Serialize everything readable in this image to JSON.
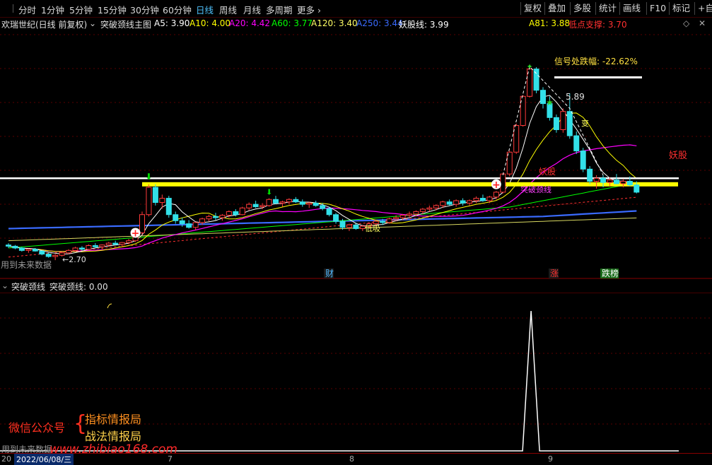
{
  "toolbar": {
    "periods": [
      "分时",
      "1分钟",
      "5分钟",
      "15分钟",
      "30分钟",
      "60分钟",
      "日线",
      "周线",
      "月线",
      "多周期",
      "更多"
    ],
    "active_period": "日线",
    "right_buttons": [
      "复权",
      "叠加",
      "多股",
      "统计",
      "画线",
      "F10",
      "标记",
      "+自选"
    ]
  },
  "info": {
    "stock": "欢瑞世纪(日线 前复权)",
    "indicator": "突破颈线主图",
    "ma": [
      {
        "label": "A5: 3.90",
        "color": "#ffffff"
      },
      {
        "label": "A10: 4.00",
        "color": "#ffff00"
      },
      {
        "label": "A20: 4.42",
        "color": "#ff00ff"
      },
      {
        "label": "A60: 3.77",
        "color": "#00ff00"
      },
      {
        "label": "A120: 3.40",
        "color": "#ffff66"
      },
      {
        "label": "A250: 3.44",
        "color": "#3a6bff"
      },
      {
        "label": "妖股线: 3.99",
        "color": "#ffffff"
      }
    ],
    "a81": "A81: 3.88",
    "support": "低点支撑: 3.70",
    "colors": {
      "a81": "#ffff00",
      "support": "#ff3030"
    }
  },
  "annotations": {
    "drop_label": "信号处跌幅: -22.62%",
    "high_price": "5.89",
    "low_price": "2.70",
    "yaogu_right": "妖股",
    "yaogu_mid": "妖股",
    "neck_text": "突破颈线",
    "bian": "变",
    "dixi": "低吸",
    "future_data": "用到未来数据",
    "markers": [
      "财",
      "涨",
      "跌榜"
    ]
  },
  "sub": {
    "title": "突破颈线",
    "value_label": "突破颈线: 0.00",
    "future_data": "用到未来数据"
  },
  "watermark": {
    "wechat": "微信公众号",
    "line1": "指标情报局",
    "line2": "战法情报局",
    "url": "www.zhibiao168.com"
  },
  "bottom": {
    "date": "2022/06/08/三",
    "prefix": "20",
    "months": [
      "7",
      "8",
      "9"
    ]
  },
  "chart_data": {
    "type": "candlestick",
    "ma_colors": {
      "a5": "#ffffff",
      "a10": "#ffff00",
      "a20": "#ff00ff",
      "a60": "#00ff00",
      "a250": "#3a6bff",
      "support": "#ff3030"
    },
    "neck_price": 3.95,
    "white_line_price": 4.05,
    "candles": [
      [
        2.95,
        2.98,
        2.9,
        2.93
      ],
      [
        2.93,
        2.95,
        2.88,
        2.9
      ],
      [
        2.9,
        2.92,
        2.84,
        2.86
      ],
      [
        2.86,
        2.89,
        2.82,
        2.88
      ],
      [
        2.88,
        2.9,
        2.84,
        2.85
      ],
      [
        2.85,
        2.86,
        2.78,
        2.8
      ],
      [
        2.8,
        2.82,
        2.74,
        2.76
      ],
      [
        2.76,
        2.8,
        2.7,
        2.78
      ],
      [
        2.78,
        2.84,
        2.76,
        2.82
      ],
      [
        2.82,
        2.88,
        2.8,
        2.86
      ],
      [
        2.86,
        2.92,
        2.84,
        2.9
      ],
      [
        2.9,
        2.93,
        2.86,
        2.88
      ],
      [
        2.88,
        2.96,
        2.86,
        2.94
      ],
      [
        2.94,
        2.98,
        2.9,
        2.92
      ],
      [
        2.92,
        2.96,
        2.88,
        2.95
      ],
      [
        2.95,
        3.0,
        2.92,
        2.98
      ],
      [
        2.98,
        3.02,
        2.95,
        2.96
      ],
      [
        2.96,
        3.0,
        2.92,
        2.99
      ],
      [
        2.99,
        3.05,
        2.96,
        3.02
      ],
      [
        3.02,
        3.2,
        3.0,
        3.15
      ],
      [
        3.15,
        3.5,
        3.12,
        3.45
      ],
      [
        3.45,
        3.95,
        3.42,
        3.9
      ],
      [
        3.9,
        3.95,
        3.6,
        3.65
      ],
      [
        3.65,
        3.78,
        3.55,
        3.72
      ],
      [
        3.72,
        3.76,
        3.4,
        3.45
      ],
      [
        3.45,
        3.5,
        3.3,
        3.35
      ],
      [
        3.35,
        3.4,
        3.25,
        3.3
      ],
      [
        3.3,
        3.36,
        3.22,
        3.24
      ],
      [
        3.24,
        3.33,
        3.2,
        3.32
      ],
      [
        3.32,
        3.4,
        3.28,
        3.38
      ],
      [
        3.38,
        3.45,
        3.34,
        3.42
      ],
      [
        3.42,
        3.48,
        3.36,
        3.4
      ],
      [
        3.4,
        3.46,
        3.35,
        3.44
      ],
      [
        3.44,
        3.52,
        3.4,
        3.5
      ],
      [
        3.5,
        3.54,
        3.42,
        3.45
      ],
      [
        3.45,
        3.58,
        3.44,
        3.56
      ],
      [
        3.56,
        3.65,
        3.52,
        3.62
      ],
      [
        3.62,
        3.68,
        3.56,
        3.58
      ],
      [
        3.58,
        3.64,
        3.54,
        3.6
      ],
      [
        3.6,
        3.72,
        3.58,
        3.7
      ],
      [
        3.7,
        3.76,
        3.62,
        3.64
      ],
      [
        3.64,
        3.68,
        3.58,
        3.66
      ],
      [
        3.66,
        3.72,
        3.62,
        3.7
      ],
      [
        3.7,
        3.74,
        3.64,
        3.66
      ],
      [
        3.66,
        3.7,
        3.58,
        3.62
      ],
      [
        3.62,
        3.66,
        3.56,
        3.64
      ],
      [
        3.64,
        3.68,
        3.58,
        3.6
      ],
      [
        3.6,
        3.64,
        3.52,
        3.55
      ],
      [
        3.55,
        3.58,
        3.42,
        3.45
      ],
      [
        3.45,
        3.48,
        3.3,
        3.34
      ],
      [
        3.34,
        3.38,
        3.2,
        3.24
      ],
      [
        3.24,
        3.3,
        3.18,
        3.28
      ],
      [
        3.28,
        3.32,
        3.2,
        3.22
      ],
      [
        3.22,
        3.28,
        3.18,
        3.26
      ],
      [
        3.26,
        3.32,
        3.22,
        3.3
      ],
      [
        3.3,
        3.36,
        3.26,
        3.34
      ],
      [
        3.34,
        3.38,
        3.28,
        3.32
      ],
      [
        3.32,
        3.4,
        3.3,
        3.38
      ],
      [
        3.38,
        3.44,
        3.34,
        3.4
      ],
      [
        3.4,
        3.46,
        3.36,
        3.44
      ],
      [
        3.44,
        3.5,
        3.4,
        3.46
      ],
      [
        3.46,
        3.52,
        3.42,
        3.5
      ],
      [
        3.5,
        3.56,
        3.46,
        3.54
      ],
      [
        3.54,
        3.6,
        3.5,
        3.56
      ],
      [
        3.56,
        3.62,
        3.52,
        3.6
      ],
      [
        3.6,
        3.68,
        3.56,
        3.66
      ],
      [
        3.66,
        3.7,
        3.6,
        3.62
      ],
      [
        3.62,
        3.7,
        3.58,
        3.68
      ],
      [
        3.68,
        3.72,
        3.6,
        3.64
      ],
      [
        3.64,
        3.7,
        3.6,
        3.68
      ],
      [
        3.68,
        3.75,
        3.64,
        3.72
      ],
      [
        3.72,
        3.78,
        3.66,
        3.68
      ],
      [
        3.68,
        3.76,
        3.64,
        3.74
      ],
      [
        3.74,
        3.84,
        3.7,
        3.82
      ],
      [
        3.82,
        4.14,
        3.8,
        4.12
      ],
      [
        4.12,
        4.5,
        4.08,
        4.48
      ],
      [
        4.48,
        4.95,
        4.45,
        4.92
      ],
      [
        4.92,
        5.42,
        4.9,
        5.4
      ],
      [
        5.4,
        5.89,
        5.38,
        5.85
      ],
      [
        5.85,
        5.88,
        5.45,
        5.5
      ],
      [
        5.5,
        5.55,
        5.2,
        5.28
      ],
      [
        5.28,
        5.4,
        5.0,
        5.05
      ],
      [
        5.05,
        5.1,
        4.8,
        4.85
      ],
      [
        4.85,
        5.2,
        4.8,
        5.15
      ],
      [
        5.15,
        5.45,
        4.7,
        4.75
      ],
      [
        4.75,
        4.82,
        4.45,
        4.5
      ],
      [
        4.5,
        4.55,
        4.15,
        4.2
      ],
      [
        4.2,
        4.25,
        3.95,
        4.0
      ],
      [
        4.0,
        4.1,
        3.88,
        4.05
      ],
      [
        4.05,
        4.1,
        3.9,
        3.98
      ],
      [
        3.98,
        4.06,
        3.92,
        4.02
      ],
      [
        4.02,
        4.12,
        3.95,
        3.96
      ],
      [
        3.96,
        4.04,
        3.9,
        4.0
      ],
      [
        4.0,
        4.08,
        3.92,
        3.94
      ],
      [
        3.94,
        4.0,
        3.8,
        3.82
      ]
    ],
    "sub_spike": {
      "index": 78,
      "value": 1
    }
  }
}
